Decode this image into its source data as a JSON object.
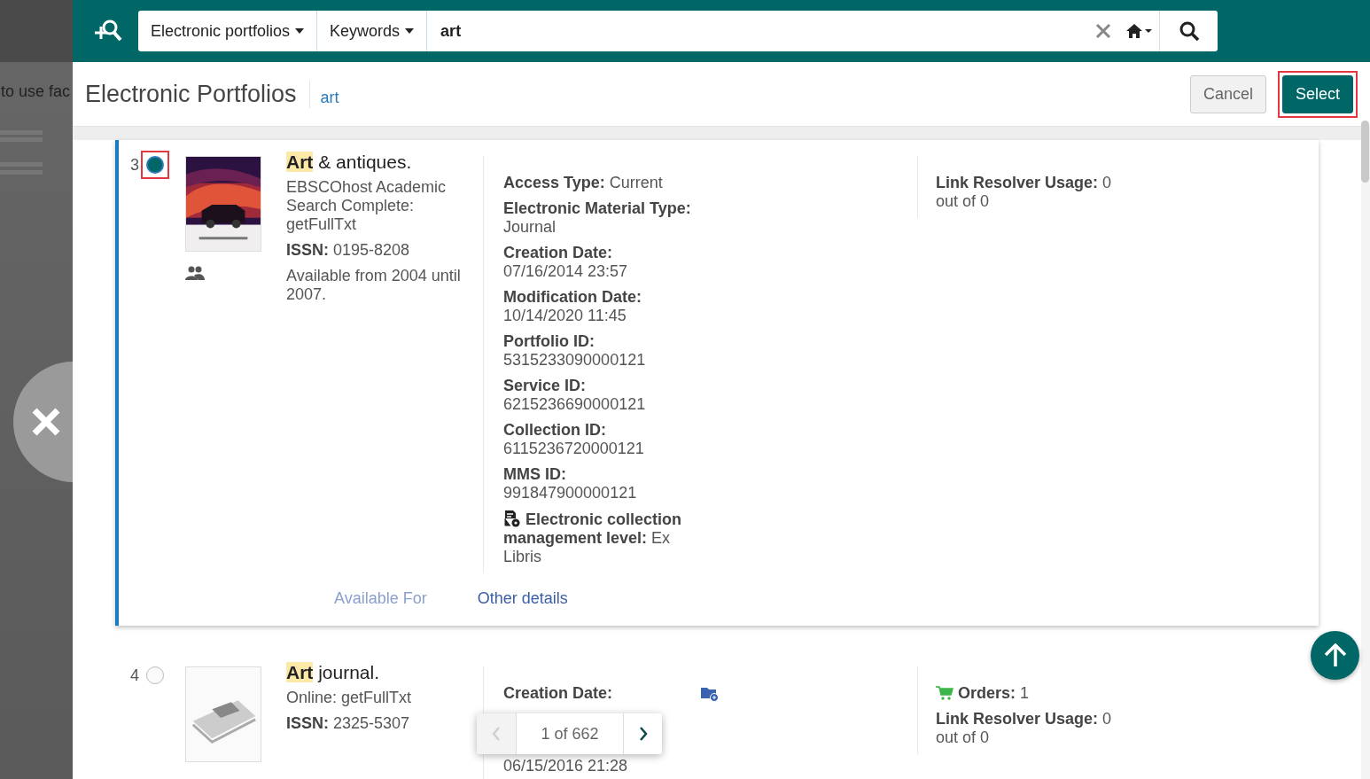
{
  "background_page": {
    "text": "to use fac"
  },
  "search_bar": {
    "scope": "Electronic portfolios",
    "field": "Keywords",
    "query": "art"
  },
  "panel": {
    "title": "Electronic Portfolios",
    "query": "art",
    "buttons": [
      {
        "label": "Cancel",
        "kind": "secondary",
        "annotated": false
      },
      {
        "label": "Select",
        "kind": "primary",
        "annotated": true
      }
    ]
  },
  "results": [
    {
      "number": "3",
      "selected": true,
      "annotated": true,
      "kind": "cover",
      "highlight": "Art",
      "title_rest": " & antiques.",
      "source": "EBSCOhost Academic Search Complete: getFullTxt",
      "issn_label": "ISSN:",
      "issn": "0195-8208",
      "availability": "Available from 2004 until 2007.",
      "details": [
        {
          "label": "Access Type:",
          "value": "Current"
        },
        {
          "label": "Electronic Material Type:",
          "value": "Journal"
        },
        {
          "label": "Creation Date:",
          "value": "07/16/2014 23:57"
        },
        {
          "label": "Modification Date:",
          "value": "10/14/2020 11:45"
        },
        {
          "label": "Portfolio ID:",
          "value": "5315233090000121"
        },
        {
          "label": "Service ID:",
          "value": "6215236690000121"
        },
        {
          "label": "Collection ID:",
          "value": "6115236720000121"
        },
        {
          "label": "MMS ID:",
          "value": "991847900000121"
        }
      ],
      "management": {
        "label": "Electronic collection management level:",
        "value": "Ex Libris"
      },
      "usage": {
        "label": "Link Resolver Usage:",
        "value": "0 out of 0"
      },
      "links": [
        {
          "label": "Available For",
          "disabled": true
        },
        {
          "label": "Other details",
          "disabled": false
        }
      ]
    },
    {
      "number": "4",
      "selected": false,
      "annotated": false,
      "kind": "newspaper",
      "highlight": "Art",
      "title_rest": " journal.",
      "source": "Online: getFullTxt",
      "issn_label": "ISSN:",
      "issn": "2325-5307",
      "details": [
        {
          "label": "Creation Date:"
        },
        {
          "value": "06/15/2016 21:28"
        }
      ],
      "orders": {
        "label": "Orders:",
        "value": "1"
      },
      "usage": {
        "label": "Link Resolver Usage:",
        "value": "0 out of 0"
      }
    }
  ],
  "pager": {
    "text": "1 of 662"
  }
}
